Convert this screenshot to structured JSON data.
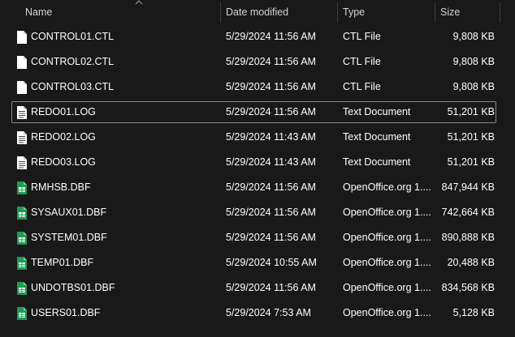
{
  "columns": {
    "name": "Name",
    "date": "Date modified",
    "type": "Type",
    "size": "Size"
  },
  "sort": {
    "column": "name",
    "icon": "sort-up-chevron-icon"
  },
  "colors": {
    "ctl_icon": "#ffffff",
    "log_icon": "#ffffff",
    "dbf_icon": "#1e9b52"
  },
  "files": [
    {
      "name": "CONTROL01.CTL",
      "date": "5/29/2024 11:56 AM",
      "type": "CTL File",
      "size": "9,808 KB",
      "icon": "blank-file-icon"
    },
    {
      "name": "CONTROL02.CTL",
      "date": "5/29/2024 11:56 AM",
      "type": "CTL File",
      "size": "9,808 KB",
      "icon": "blank-file-icon"
    },
    {
      "name": "CONTROL03.CTL",
      "date": "5/29/2024 11:56 AM",
      "type": "CTL File",
      "size": "9,808 KB",
      "icon": "blank-file-icon"
    },
    {
      "name": "REDO01.LOG",
      "date": "5/29/2024 11:56 AM",
      "type": "Text Document",
      "size": "51,201 KB",
      "icon": "text-file-icon",
      "focused": true
    },
    {
      "name": "REDO02.LOG",
      "date": "5/29/2024 11:43 AM",
      "type": "Text Document",
      "size": "51,201 KB",
      "icon": "text-file-icon"
    },
    {
      "name": "REDO03.LOG",
      "date": "5/29/2024 11:43 AM",
      "type": "Text Document",
      "size": "51,201 KB",
      "icon": "text-file-icon"
    },
    {
      "name": "RMHSB.DBF",
      "date": "5/29/2024 11:56 AM",
      "type": "OpenOffice.org 1....",
      "size": "847,944 KB",
      "icon": "spreadsheet-file-icon"
    },
    {
      "name": "SYSAUX01.DBF",
      "date": "5/29/2024 11:56 AM",
      "type": "OpenOffice.org 1....",
      "size": "742,664 KB",
      "icon": "spreadsheet-file-icon"
    },
    {
      "name": "SYSTEM01.DBF",
      "date": "5/29/2024 11:56 AM",
      "type": "OpenOffice.org 1....",
      "size": "890,888 KB",
      "icon": "spreadsheet-file-icon"
    },
    {
      "name": "TEMP01.DBF",
      "date": "5/29/2024 10:55 AM",
      "type": "OpenOffice.org 1....",
      "size": "20,488 KB",
      "icon": "spreadsheet-file-icon"
    },
    {
      "name": "UNDOTBS01.DBF",
      "date": "5/29/2024 11:56 AM",
      "type": "OpenOffice.org 1....",
      "size": "834,568 KB",
      "icon": "spreadsheet-file-icon"
    },
    {
      "name": "USERS01.DBF",
      "date": "5/29/2024 7:53 AM",
      "type": "OpenOffice.org 1....",
      "size": "5,128 KB",
      "icon": "spreadsheet-file-icon"
    }
  ]
}
